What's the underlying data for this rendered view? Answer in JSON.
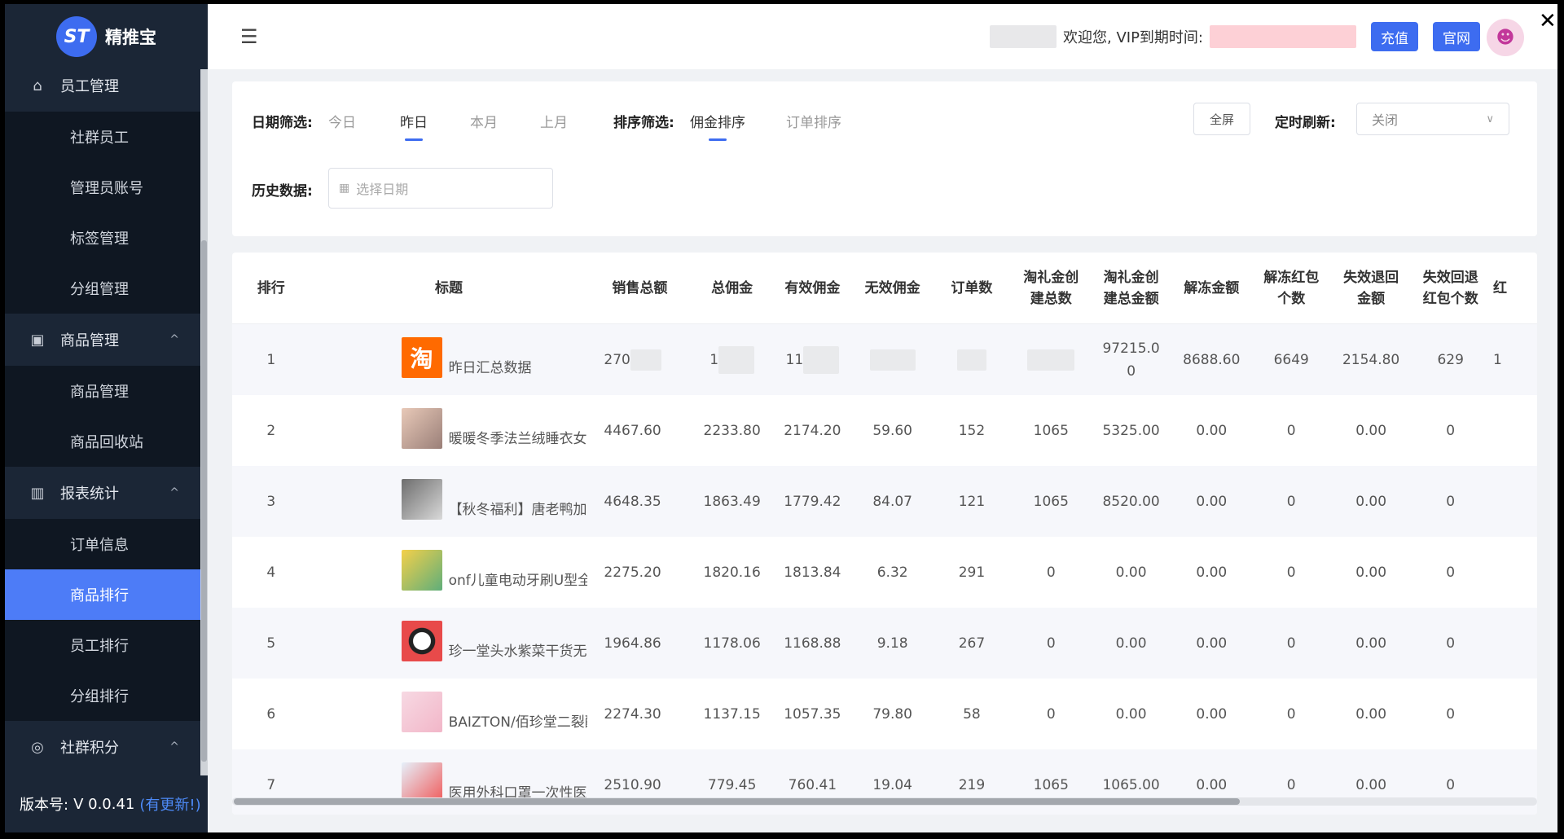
{
  "brand": {
    "logo_glyph": "ST",
    "name": "精推宝"
  },
  "sidebar": {
    "groups": [
      {
        "label": "员工管理",
        "icon": "user-icon",
        "items": [
          "社群员工",
          "管理员账号",
          "标签管理",
          "分组管理"
        ]
      },
      {
        "label": "商品管理",
        "icon": "clipboard-icon",
        "chevron": "^",
        "items": [
          "商品管理",
          "商品回收站"
        ]
      },
      {
        "label": "报表统计",
        "icon": "bar-chart-icon",
        "chevron": "^",
        "items": [
          "订单信息",
          "商品排行",
          "员工排行",
          "分组排行"
        ]
      },
      {
        "label": "社群积分",
        "icon": "coins-icon",
        "chevron": "^",
        "items": []
      }
    ],
    "active_item": "商品排行"
  },
  "version": {
    "label": "版本号:",
    "value": "V 0.0.41",
    "update": "(有更新!)"
  },
  "header": {
    "menu_icon": "☰",
    "welcome": "欢迎您, VIP到期时间:",
    "recharge": "充值",
    "official": "官网",
    "close": "✕"
  },
  "filters": {
    "date_label": "日期筛选:",
    "date_options": [
      "今日",
      "昨日",
      "本月",
      "上月"
    ],
    "date_selected": "昨日",
    "sort_label": "排序筛选:",
    "sort_options": [
      "佣金排序",
      "订单排序"
    ],
    "sort_selected": "佣金排序",
    "fullscreen": "全屏",
    "refresh_label": "定时刷新:",
    "refresh_value": "关闭",
    "history_label": "历史数据:",
    "history_placeholder": "选择日期"
  },
  "table": {
    "columns": [
      "排行",
      "标题",
      "销售总额",
      "总佣金",
      "有效佣金",
      "无效佣金",
      "订单数",
      "淘礼金创建总数",
      "淘礼金创建总金额",
      "解冻金额",
      "解冻红包个数",
      "失效退回金额",
      "失效回退红包个数",
      "红"
    ],
    "rows": [
      {
        "rank": "1",
        "title": "昨日汇总数据",
        "thumb": "tb",
        "thumb_glyph": "淘",
        "sales": "270",
        "total_comm": "1",
        "valid_comm": "11",
        "invalid_comm": "",
        "orders": "",
        "tlj_count": "",
        "tlj_amount": "97215.00",
        "unfreeze_amt": "8688.60",
        "unfreeze_cnt": "6649",
        "expired_amt": "2154.80",
        "expired_cnt": "629",
        "extra": "1"
      },
      {
        "rank": "2",
        "title": "暖暖冬季法兰绒睡衣女加绒加厚...",
        "thumb": "p1",
        "sales": "4467.60",
        "total_comm": "2233.80",
        "valid_comm": "2174.20",
        "invalid_comm": "59.60",
        "orders": "152",
        "tlj_count": "1065",
        "tlj_amount": "5325.00",
        "unfreeze_amt": "0.00",
        "unfreeze_cnt": "0",
        "expired_amt": "0.00",
        "expired_cnt": "0",
        "extra": ""
      },
      {
        "rank": "3",
        "title": "【秋冬福利】唐老鸭加绒秋冬季in...",
        "thumb": "p2",
        "sales": "4648.35",
        "total_comm": "1863.49",
        "valid_comm": "1779.42",
        "invalid_comm": "84.07",
        "orders": "121",
        "tlj_count": "1065",
        "tlj_amount": "8520.00",
        "unfreeze_amt": "0.00",
        "unfreeze_cnt": "0",
        "expired_amt": "0.00",
        "expired_cnt": "0",
        "extra": ""
      },
      {
        "rank": "4",
        "title": "onf儿童电动牙刷U型全自动宝宝...",
        "thumb": "p3",
        "sales": "2275.20",
        "total_comm": "1820.16",
        "valid_comm": "1813.84",
        "invalid_comm": "6.32",
        "orders": "291",
        "tlj_count": "0",
        "tlj_amount": "0.00",
        "unfreeze_amt": "0.00",
        "unfreeze_cnt": "0",
        "expired_amt": "0.00",
        "expired_cnt": "0",
        "extra": ""
      },
      {
        "rank": "5",
        "title": "珍一堂头水紫菜干货无沙免洗凉...",
        "thumb": "p4",
        "sales": "1964.86",
        "total_comm": "1178.06",
        "valid_comm": "1168.88",
        "invalid_comm": "9.18",
        "orders": "267",
        "tlj_count": "0",
        "tlj_amount": "0.00",
        "unfreeze_amt": "0.00",
        "unfreeze_cnt": "0",
        "expired_amt": "0.00",
        "expired_cnt": "0",
        "extra": ""
      },
      {
        "rank": "6",
        "title": "BAIZTON/佰珍堂二裂酵母奢润美...",
        "thumb": "p5",
        "sales": "2274.30",
        "total_comm": "1137.15",
        "valid_comm": "1057.35",
        "invalid_comm": "79.80",
        "orders": "58",
        "tlj_count": "0",
        "tlj_amount": "0.00",
        "unfreeze_amt": "0.00",
        "unfreeze_cnt": "0",
        "expired_amt": "0.00",
        "expired_cnt": "0",
        "extra": ""
      },
      {
        "rank": "7",
        "title": "医用外科口罩一次性医疗灭菌外...",
        "thumb": "p6",
        "sales": "2510.90",
        "total_comm": "779.45",
        "valid_comm": "760.41",
        "invalid_comm": "19.04",
        "orders": "219",
        "tlj_count": "1065",
        "tlj_amount": "1065.00",
        "unfreeze_amt": "0.00",
        "unfreeze_cnt": "0",
        "expired_amt": "0.00",
        "expired_cnt": "0",
        "extra": ""
      }
    ]
  },
  "colors": {
    "primary": "#3d6cf0",
    "sidebar_bg": "#1b2636",
    "sidebar_sub_bg": "#0f1722",
    "active_item": "#4d7cf7"
  }
}
